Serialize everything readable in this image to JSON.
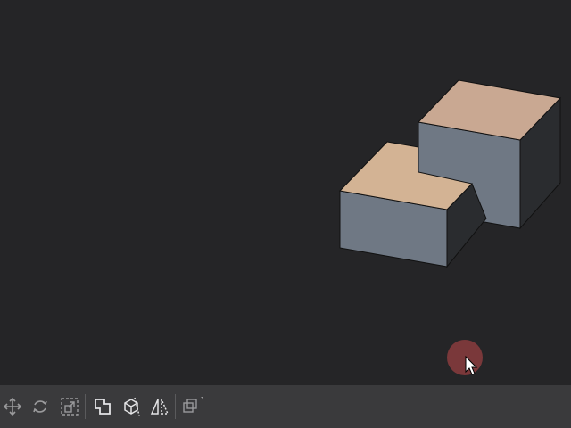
{
  "viewport": {
    "background": "#252527",
    "objects": [
      {
        "name": "box-rear",
        "top_color": "#c9a892",
        "side_color": "#6f7884",
        "dark_side_color": "#2a2c2f"
      },
      {
        "name": "box-front",
        "top_color": "#d3b394",
        "side_color": "#6f7884",
        "dark_side_color": "#2a2c2f"
      }
    ],
    "cursor_highlight_color": "#8a3c3e"
  },
  "toolbar": {
    "background": "#3a3a3c",
    "icon_color": "#9a9a9c",
    "active_icon_color": "#e4e4e6",
    "tools": [
      {
        "id": "move",
        "icon": "move-icon",
        "active": false
      },
      {
        "id": "rotate",
        "icon": "rotate-icon",
        "active": false
      },
      {
        "id": "scale",
        "icon": "scale-icon",
        "active": false
      },
      {
        "id": "boolean",
        "icon": "boolean-union-icon",
        "active": true
      },
      {
        "id": "section",
        "icon": "section-cut-icon",
        "active": true
      },
      {
        "id": "mirror",
        "icon": "mirror-icon",
        "active": true
      },
      {
        "id": "duplicate",
        "icon": "duplicate-icon",
        "active": false
      }
    ]
  }
}
